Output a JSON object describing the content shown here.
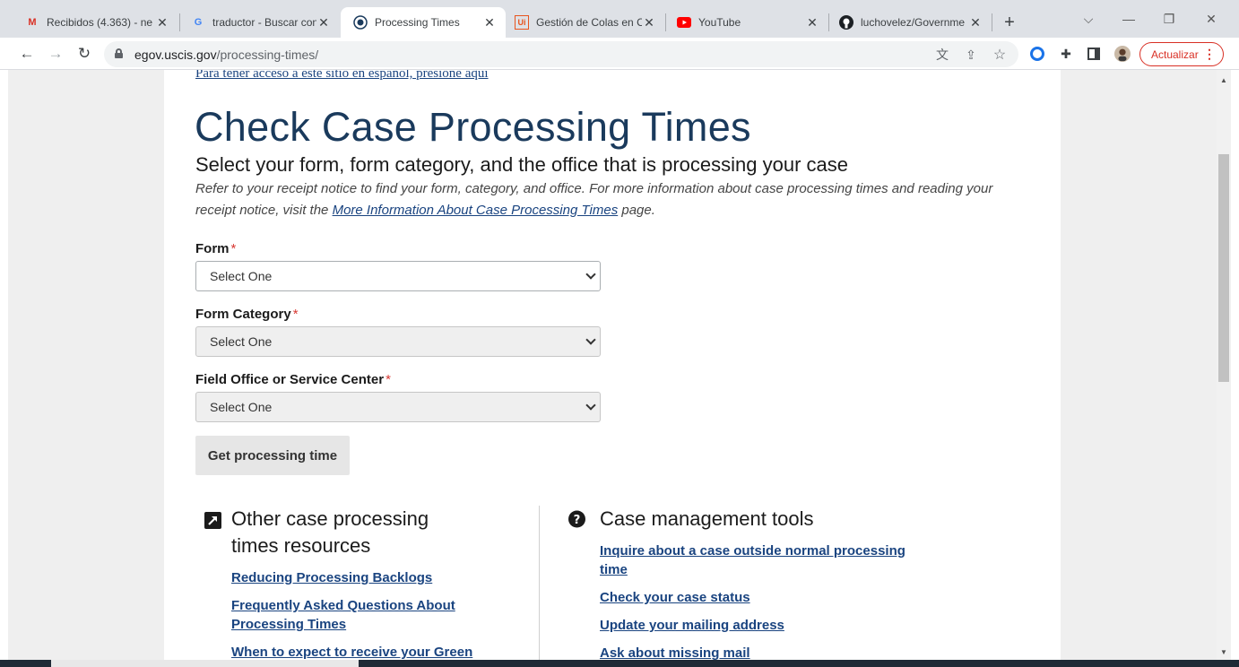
{
  "browser": {
    "tabs": [
      {
        "title": "Recibidos (4.363) - ne",
        "icon": "gmail-icon",
        "active": false
      },
      {
        "title": "traductor - Buscar con",
        "icon": "google-icon",
        "active": false
      },
      {
        "title": "Processing Times",
        "icon": "uscis-seal-icon",
        "active": true
      },
      {
        "title": "Gestión de Colas en C",
        "icon": "uipath-icon",
        "active": false
      },
      {
        "title": "YouTube",
        "icon": "youtube-icon",
        "active": false
      },
      {
        "title": "luchovelez/Governme",
        "icon": "github-icon",
        "active": false
      }
    ],
    "url_domain": "egov.uscis.gov",
    "url_path": "/processing-times/",
    "update_label": "Actualizar"
  },
  "page": {
    "spanish_link": "Para tener acceso a este sitio en español, presione aquí",
    "title": "Check Case Processing Times",
    "subtitle": "Select your form, form category, and the office that is processing your case",
    "intro_before": "Refer to your receipt notice to find your form, category, and office. For more information about case processing times and reading your receipt notice, visit the ",
    "intro_link": "More Information About Case Processing Times",
    "intro_after": " page.",
    "form_label": "Form",
    "form_value": "Select One",
    "category_label": "Form Category",
    "category_value": "Select One",
    "office_label": "Field Office or Service Center",
    "office_value": "Select One",
    "required_mark": "*",
    "submit_label": "Get processing time"
  },
  "resources": {
    "title_line1": "Other case processing",
    "title_line2": "times resources",
    "links": [
      "Reducing Processing Backlogs",
      "Frequently Asked Questions About",
      "Processing Times",
      "When to expect to receive your Green"
    ]
  },
  "tools": {
    "title": "Case management tools",
    "links": [
      "Inquire about a case outside normal processing",
      "time",
      "Check your case status",
      "Update your mailing address",
      "Ask about missing mail"
    ]
  },
  "colors": {
    "heading": "#1a3a5c",
    "link": "#1a4480",
    "required": "#d83933",
    "update": "#d93025"
  }
}
